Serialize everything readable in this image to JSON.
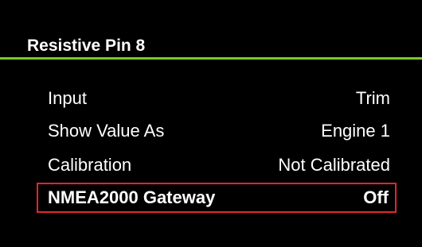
{
  "header": {
    "title": "Resistive Pin 8",
    "accent_color": "#7cc82c"
  },
  "menu": {
    "items": [
      {
        "label": "Input",
        "value": "Trim"
      },
      {
        "label": "Show Value As",
        "value": "Engine 1"
      },
      {
        "label": "Calibration",
        "value": "Not Calibrated"
      },
      {
        "label": "NMEA2000 Gateway",
        "value": "Off"
      }
    ],
    "selected_index": 3,
    "selection_color": "#e3262b"
  }
}
